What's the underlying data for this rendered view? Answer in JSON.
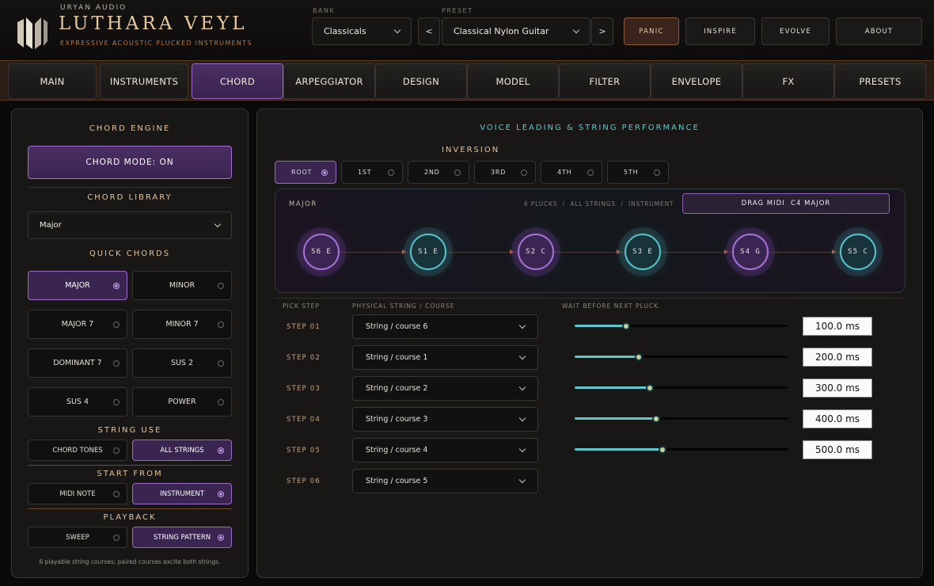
{
  "brand": {
    "company": "URYAN AUDIO",
    "name": "LUTHARA VEYL",
    "tagline": "EXPRESSIVE ACOUSTIC PLUCKED INSTRUMENTS"
  },
  "header": {
    "bank_label": "BANK",
    "bank_value": "Classicals",
    "preset_label": "PRESET",
    "preset_value": "Classical Nylon Guitar",
    "prev": "<",
    "next": ">",
    "buttons": [
      "PANIC",
      "INSPIRE",
      "EVOLVE",
      "ABOUT"
    ]
  },
  "tabs": [
    "MAIN",
    "INSTRUMENTS",
    "CHORD",
    "ARPEGGIATOR",
    "DESIGN",
    "MODEL",
    "FILTER",
    "ENVELOPE",
    "FX",
    "PRESETS"
  ],
  "active_tab": "CHORD",
  "left": {
    "engine_title": "CHORD ENGINE",
    "chord_mode": "CHORD MODE: ON",
    "library_title": "CHORD LIBRARY",
    "library_value": "Major",
    "quick_title": "QUICK CHORDS",
    "quick": [
      "MAJOR",
      "MINOR",
      "MAJOR 7",
      "MINOR 7",
      "DOMINANT 7",
      "SUS 2",
      "SUS 4",
      "POWER"
    ],
    "quick_selected": "MAJOR",
    "string_use_title": "STRING USE",
    "string_use": [
      "CHORD TONES",
      "ALL STRINGS"
    ],
    "string_use_selected": "ALL STRINGS",
    "start_title": "START FROM",
    "start": [
      "MIDI NOTE",
      "INSTRUMENT"
    ],
    "start_selected": "INSTRUMENT",
    "playback_title": "PLAYBACK",
    "playback": [
      "SWEEP",
      "STRING PATTERN"
    ],
    "playback_selected": "STRING PATTERN",
    "footnote": "6 playable string courses; paired courses excite both strings."
  },
  "main": {
    "title": "VOICE LEADING & STRING PERFORMANCE",
    "inversion_title": "INVERSION",
    "inversions": [
      "ROOT",
      "1ST",
      "2ND",
      "3RD",
      "4TH",
      "5TH"
    ],
    "inversion_selected": "ROOT",
    "chord_name": "MAJOR",
    "info": "6 PLUCKS  /  ALL STRINGS  /  INSTRUMENT",
    "drag": "DRAG MIDI  C4 MAJOR",
    "nodes": [
      {
        "label": "S6  E",
        "kind": "p"
      },
      {
        "label": "S1  E",
        "kind": "t"
      },
      {
        "label": "S2  C",
        "kind": "p"
      },
      {
        "label": "S3  E",
        "kind": "t"
      },
      {
        "label": "S4  G",
        "kind": "p"
      },
      {
        "label": "S5  C",
        "kind": "t"
      }
    ],
    "col_step": "PICK STEP",
    "col_string": "PHYSICAL STRING / COURSE",
    "col_wait": "WAIT BEFORE NEXT PLUCK",
    "steps": [
      {
        "label": "STEP 01",
        "string": "String / course 6",
        "wait": "100.0 ms",
        "level": 0.24
      },
      {
        "label": "STEP 02",
        "string": "String / course 1",
        "wait": "200.0 ms",
        "level": 0.3
      },
      {
        "label": "STEP 03",
        "string": "String / course 2",
        "wait": "300.0 ms",
        "level": 0.35
      },
      {
        "label": "STEP 04",
        "string": "String / course 3",
        "wait": "400.0 ms",
        "level": 0.38
      },
      {
        "label": "STEP 05",
        "string": "String / course 4",
        "wait": "500.0 ms",
        "level": 0.41
      },
      {
        "label": "STEP 06",
        "string": "String / course 5"
      }
    ]
  },
  "colors": {
    "accent_purple": "#9a6ac8",
    "accent_teal": "#5fc8cf",
    "brand_gold": "#e6c9a0"
  }
}
